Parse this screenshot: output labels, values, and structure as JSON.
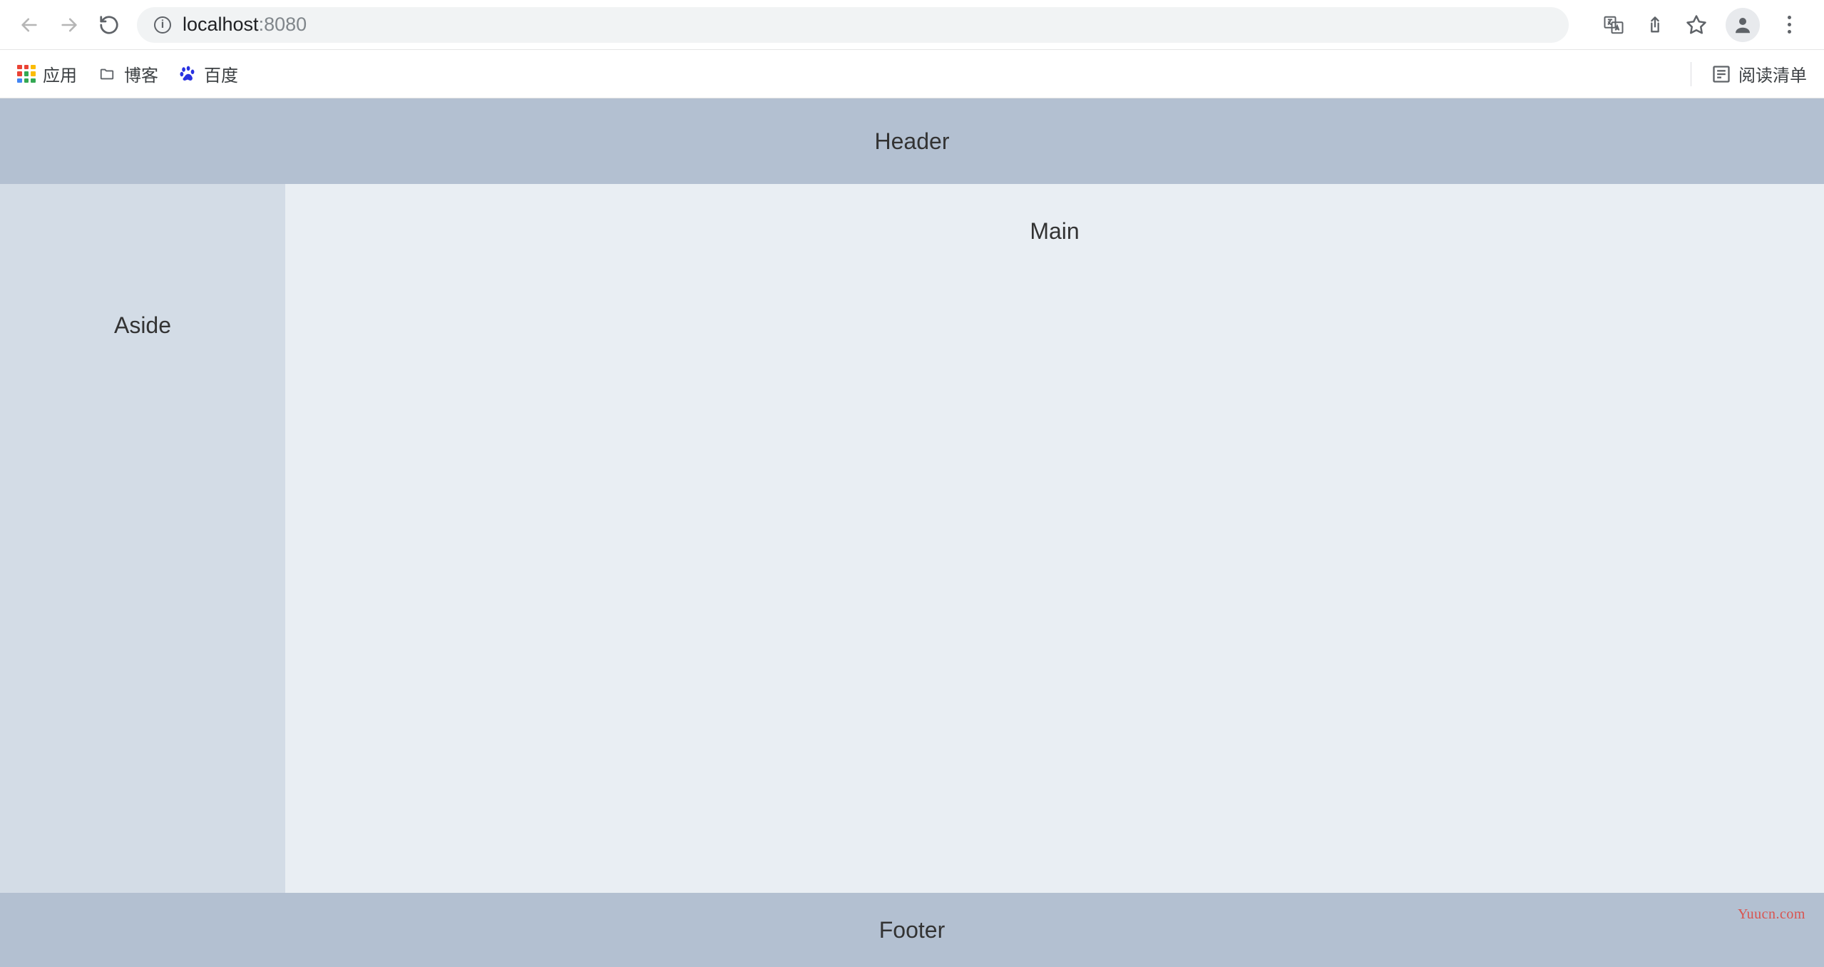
{
  "browser": {
    "address": {
      "host": "localhost",
      "port": ":8080"
    }
  },
  "bookmarks": {
    "apps_label": "应用",
    "blog_label": "博客",
    "baidu_label": "百度",
    "reading_list_label": "阅读清单"
  },
  "page": {
    "header_text": "Header",
    "aside_text": "Aside",
    "main_text": "Main",
    "footer_text": "Footer",
    "watermark": "Yuucn.com"
  }
}
